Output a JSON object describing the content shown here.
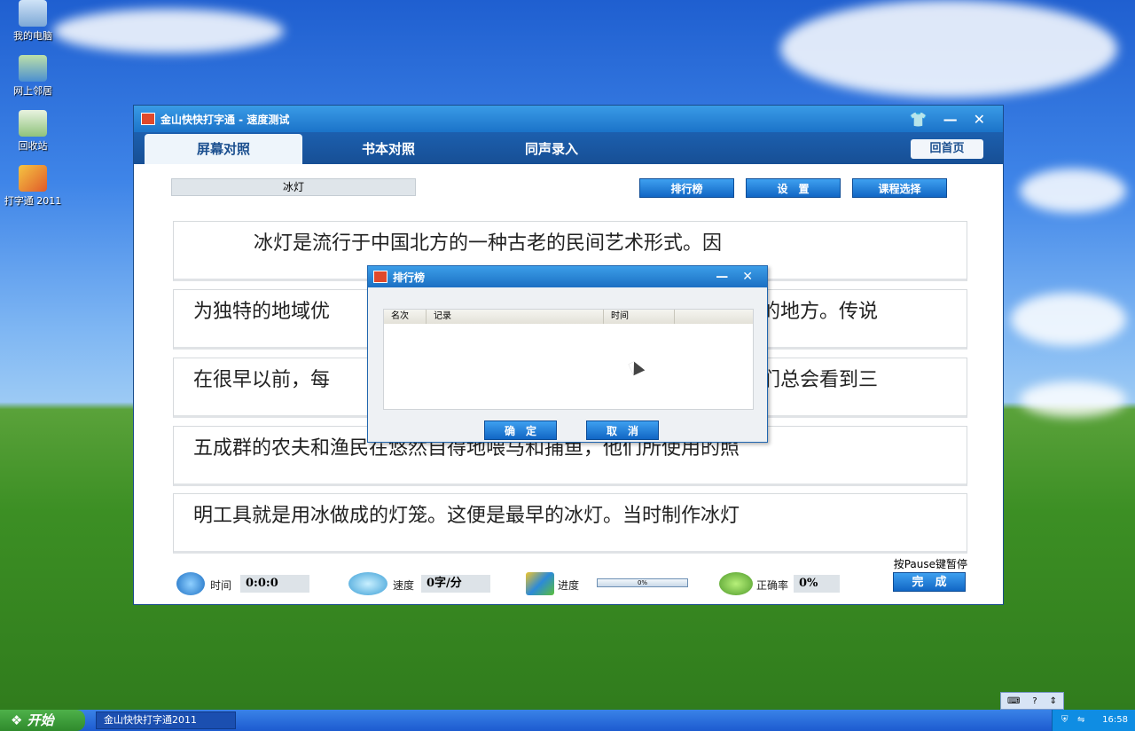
{
  "desktop": {
    "icons": [
      {
        "label": "我的电脑"
      },
      {
        "label": "网上邻居"
      },
      {
        "label": "回收站"
      },
      {
        "label": "打字通 2011"
      }
    ]
  },
  "window": {
    "title": "金山快快打字通 - 速度测试",
    "title_ctrls": {
      "skin": "👕",
      "minimize": "—",
      "close": "✕"
    },
    "tabs": [
      {
        "label": "屏幕对照",
        "active": true
      },
      {
        "label": "书本对照",
        "active": false
      },
      {
        "label": "同声录入",
        "active": false
      }
    ],
    "home_label": "回首页",
    "lesson_name": "冰灯",
    "buttons": {
      "ranking": "排行榜",
      "settings": "设　置",
      "course": "课程选择"
    },
    "lines": [
      "冰灯是流行于中国北方的一种古老的民间艺术形式。因",
      "为独特的地域优",
      "的地方。传说",
      "在很早以前，每",
      "们总会看到三",
      "五成群的农夫和渔民在悠然自得地喂马和捕鱼，他们所使用的照",
      "明工具就是用冰做成的灯笼。这便是最早的冰灯。当时制作冰灯"
    ],
    "status": {
      "time_label": "时间",
      "time_value": "0:0:0",
      "speed_label": "速度",
      "speed_value": "0字/分",
      "progress_label": "进度",
      "progress_value": "0%",
      "progress_fraction": 0,
      "accuracy_label": "正确率",
      "accuracy_value": "0%",
      "pause_hint": "按Pause键暂停",
      "done_label": "完　成"
    }
  },
  "dialog": {
    "title": "排行榜",
    "ctrls": {
      "minimize": "—",
      "close": "✕"
    },
    "columns": [
      "名次",
      "记录",
      "时间"
    ],
    "ok_label": "确　定",
    "cancel_label": "取　消"
  },
  "taskbar": {
    "start_label": "开始",
    "task_label": "金山快快打字通2011",
    "clock": "16:58"
  },
  "colors": {
    "accent": "#1b73c9",
    "title_blue": "#3a9be6",
    "desktop_grass": "#3c8f24"
  }
}
